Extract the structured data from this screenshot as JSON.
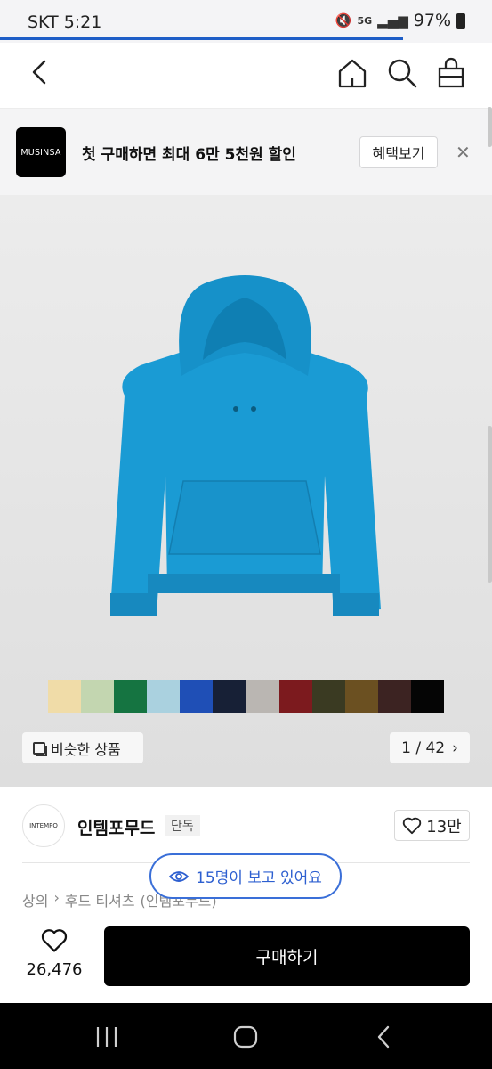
{
  "status_bar": {
    "carrier_time": "SKT 5:21",
    "network": "5G",
    "battery": "97%"
  },
  "nav": {
    "back_icon": "back-arrow-icon",
    "home_icon": "home-icon",
    "search_icon": "search-icon",
    "cart_icon": "shopping-bag-icon"
  },
  "promo": {
    "logo_text": "MUSINSA",
    "message": "첫 구매하면 최대 6만 5천원 할인",
    "button_label": "혜택보기",
    "close_label": "✕"
  },
  "product": {
    "main_color": "#1a9bd4",
    "swatches": [
      "#f0dca8",
      "#c3d6b0",
      "#157441",
      "#aad1df",
      "#1f4fb6",
      "#172036",
      "#bab6b2",
      "#7c1a1e",
      "#3a3a22",
      "#6b5021",
      "#3c2322",
      "#050505"
    ],
    "similar_label": "비슷한 상품",
    "page_indicator": "1 / 42",
    "page_next": "›"
  },
  "brand": {
    "logo_text": "INTEMPO",
    "name": "인템포무드",
    "badge": "단독",
    "likes": "13만"
  },
  "breadcrumb": [
    "상의",
    "›",
    "후드 티셔츠",
    "(인템포무드)"
  ],
  "viewers": "15명이 보고 있어요",
  "purchase": {
    "wish_count": "26,476",
    "buy_label": "구매하기"
  }
}
